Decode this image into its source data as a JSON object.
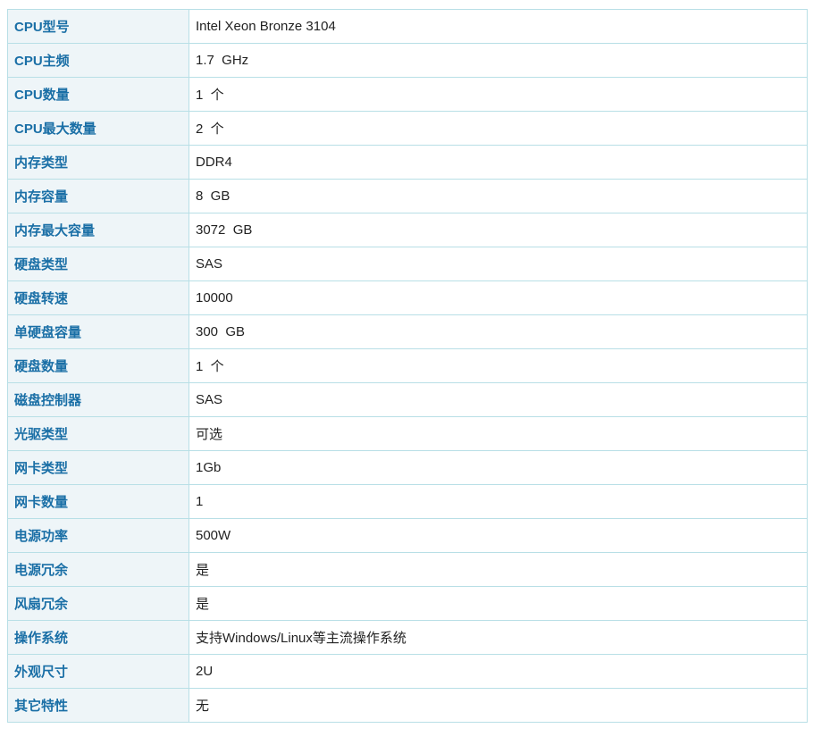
{
  "specs": [
    {
      "label": "CPU型号",
      "value": "Intel Xeon Bronze 3104"
    },
    {
      "label": "CPU主频",
      "value": "1.7  GHz"
    },
    {
      "label": "CPU数量",
      "value": "1  个"
    },
    {
      "label": "CPU最大数量",
      "value": "2  个"
    },
    {
      "label": "内存类型",
      "value": "DDR4"
    },
    {
      "label": "内存容量",
      "value": "8  GB"
    },
    {
      "label": "内存最大容量",
      "value": "3072  GB"
    },
    {
      "label": "硬盘类型",
      "value": "SAS"
    },
    {
      "label": "硬盘转速",
      "value": "10000"
    },
    {
      "label": "单硬盘容量",
      "value": "300  GB"
    },
    {
      "label": "硬盘数量",
      "value": "1  个"
    },
    {
      "label": "磁盘控制器",
      "value": "SAS"
    },
    {
      "label": "光驱类型",
      "value": "可选"
    },
    {
      "label": "网卡类型",
      "value": "1Gb"
    },
    {
      "label": "网卡数量",
      "value": "1"
    },
    {
      "label": "电源功率",
      "value": "500W"
    },
    {
      "label": "电源冗余",
      "value": "是"
    },
    {
      "label": "风扇冗余",
      "value": "是"
    },
    {
      "label": "操作系统",
      "value": "支持Windows/Linux等主流操作系统"
    },
    {
      "label": "外观尺寸",
      "value": "2U"
    },
    {
      "label": "其它特性",
      "value": "无"
    }
  ],
  "colors": {
    "label_text": "#1a6fa6",
    "label_bg": "#eef5f8",
    "border": "#b8dfe6"
  }
}
